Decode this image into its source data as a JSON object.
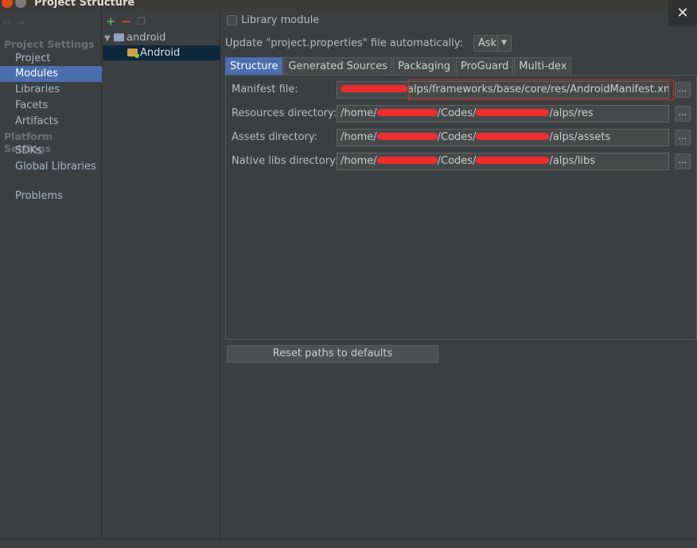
{
  "window": {
    "title": "Project Structure",
    "close_glyph": "✕"
  },
  "sidebar": {
    "project_settings_header": "Project Settings",
    "project_settings_items": [
      {
        "label": "Project"
      },
      {
        "label": "Modules",
        "selected": true
      },
      {
        "label": "Libraries"
      },
      {
        "label": "Facets"
      },
      {
        "label": "Artifacts"
      }
    ],
    "platform_settings_header": "Platform Settings",
    "platform_settings_items": [
      {
        "label": "SDKs"
      },
      {
        "label": "Global Libraries"
      }
    ],
    "problems_label": "Problems"
  },
  "tree": {
    "toolbar": {
      "add": "+",
      "remove": "−",
      "copy": "❐"
    },
    "root": {
      "label": "android",
      "expanded": true
    },
    "child": {
      "label": "Android",
      "selected": true
    }
  },
  "content": {
    "library_module_label": "Library module",
    "update_label": "Update \"project.properties\" file automatically:",
    "update_value": "Ask",
    "tabs": [
      {
        "label": "Structure",
        "active": true
      },
      {
        "label": "Generated Sources"
      },
      {
        "label": "Packaging"
      },
      {
        "label": "ProGuard"
      },
      {
        "label": "Multi-dex"
      }
    ],
    "fields": {
      "manifest": {
        "label": "Manifest file:",
        "prefix": "",
        "middle": "",
        "suffix": "alps/frameworks/base/core/res/AndroidManifest.xml"
      },
      "resources": {
        "label": "Resources directory:",
        "prefix": "/home/",
        "middle": "/Codes/",
        "suffix": "/alps/res"
      },
      "assets": {
        "label": "Assets directory:",
        "prefix": "/home/",
        "middle": "/Codes/",
        "suffix": "/alps/assets"
      },
      "native_libs": {
        "label": "Native libs directory:",
        "prefix": "/home/",
        "middle": "/Codes/",
        "suffix": "/alps/libs"
      }
    },
    "browse_label": "...",
    "reset_label": "Reset paths to defaults"
  },
  "colors": {
    "background": "#3c3f41",
    "selection": "#4b6eaf",
    "tree_selection": "#0d293e",
    "redaction": "#ff2b2b",
    "highlight_border": "#e02424"
  }
}
